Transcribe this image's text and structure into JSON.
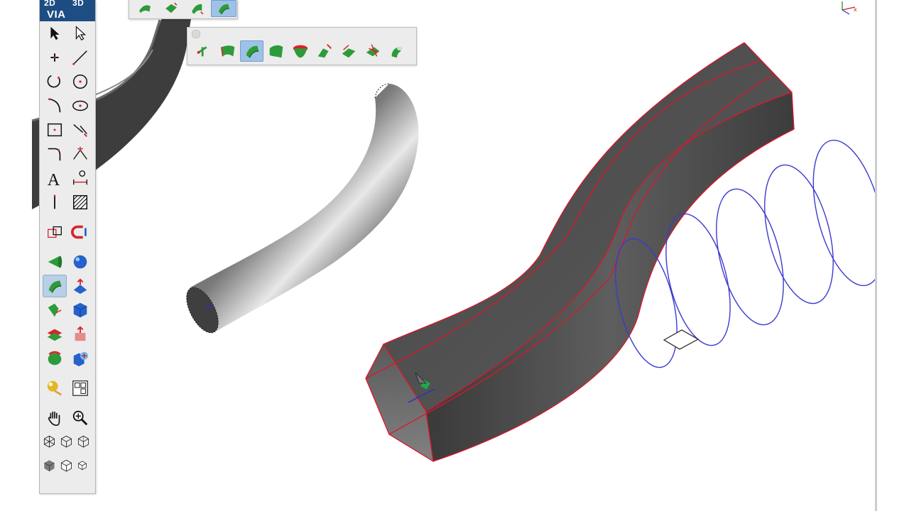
{
  "app": {
    "title": ""
  },
  "tool_palette": {
    "header": {
      "label_2d": "2D",
      "label_3d": "3D",
      "label_via": "VIA"
    },
    "tools": [
      [
        "arrow-select-icon",
        "hollow-arrow-select-icon"
      ],
      [
        "point-icon",
        "line-icon"
      ],
      [
        "arc-icon",
        "circle-icon"
      ],
      [
        "fillet-arc-icon",
        "ellipse-icon"
      ],
      [
        "rectangle-icon",
        "trim-icon"
      ],
      [
        "corner-icon",
        "intersection-icon"
      ],
      [
        "text-icon",
        "dimension-icon"
      ],
      [
        "cursor-line-icon",
        "hatch-icon"
      ],
      [
        "transform-icon",
        "magnet-icon"
      ],
      [
        "cone-icon",
        "sphere-icon"
      ],
      [
        "sweep-icon",
        "extrude-surface-icon"
      ],
      [
        "loft-icon",
        "cube-icon"
      ],
      [
        "layers-icon",
        "push-pull-icon"
      ],
      [
        "revolve-icon",
        "boolean-icon"
      ],
      [
        "render-icon",
        "views-icon"
      ],
      [
        "hand-pan-icon",
        "zoom-icon"
      ],
      [
        "view-wire-icon",
        "view-iso-icon",
        "view-iso2-icon"
      ],
      [
        "view-shaded-icon",
        "view-hidden-icon",
        "view-small-icon"
      ]
    ],
    "active_tool": "sweep-icon"
  },
  "surface_toolbar": {
    "tools": [
      "sweep-point-icon",
      "ruled-surface-icon",
      "swept-surface-icon",
      "patch-surface-icon",
      "revolved-surface-icon",
      "blend-surface-icon",
      "offset-surface-icon",
      "trim-surface-icon",
      "tube-surface-icon"
    ],
    "active_tool": "swept-surface-icon"
  },
  "top_toolbar": {
    "tools": [
      "surface-a-icon",
      "surface-b-icon",
      "surface-c-icon",
      "surface-d-icon"
    ],
    "active_tool": "surface-d-icon"
  },
  "axis_indicator": {
    "x_label": "x"
  },
  "colors": {
    "palette_header": "#1d4d83",
    "model_surface": "#4a4a4a",
    "edge_highlight": "#e0142b",
    "helix_curve": "#3a3ad0",
    "active_tool_bg": "#b8cfe6"
  }
}
